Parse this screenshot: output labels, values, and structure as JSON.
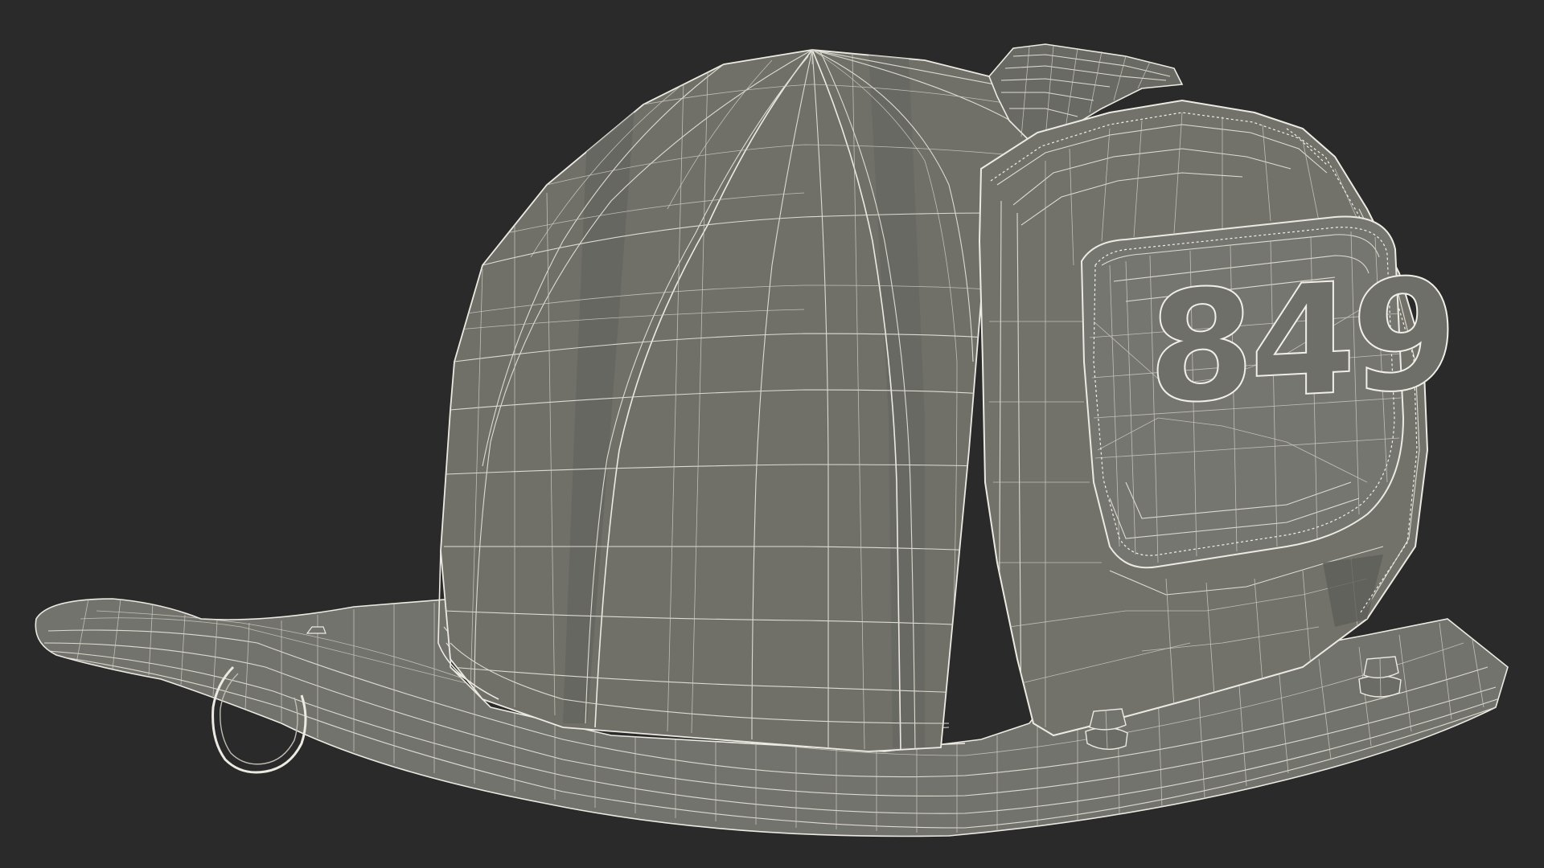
{
  "scene": {
    "background_color": "#2a2a2a",
    "mesh_fill_color": "#6f6f69",
    "mesh_dark_color": "#5c5c57",
    "wire_color": "#dedbd0"
  },
  "badge": {
    "number": "849"
  }
}
